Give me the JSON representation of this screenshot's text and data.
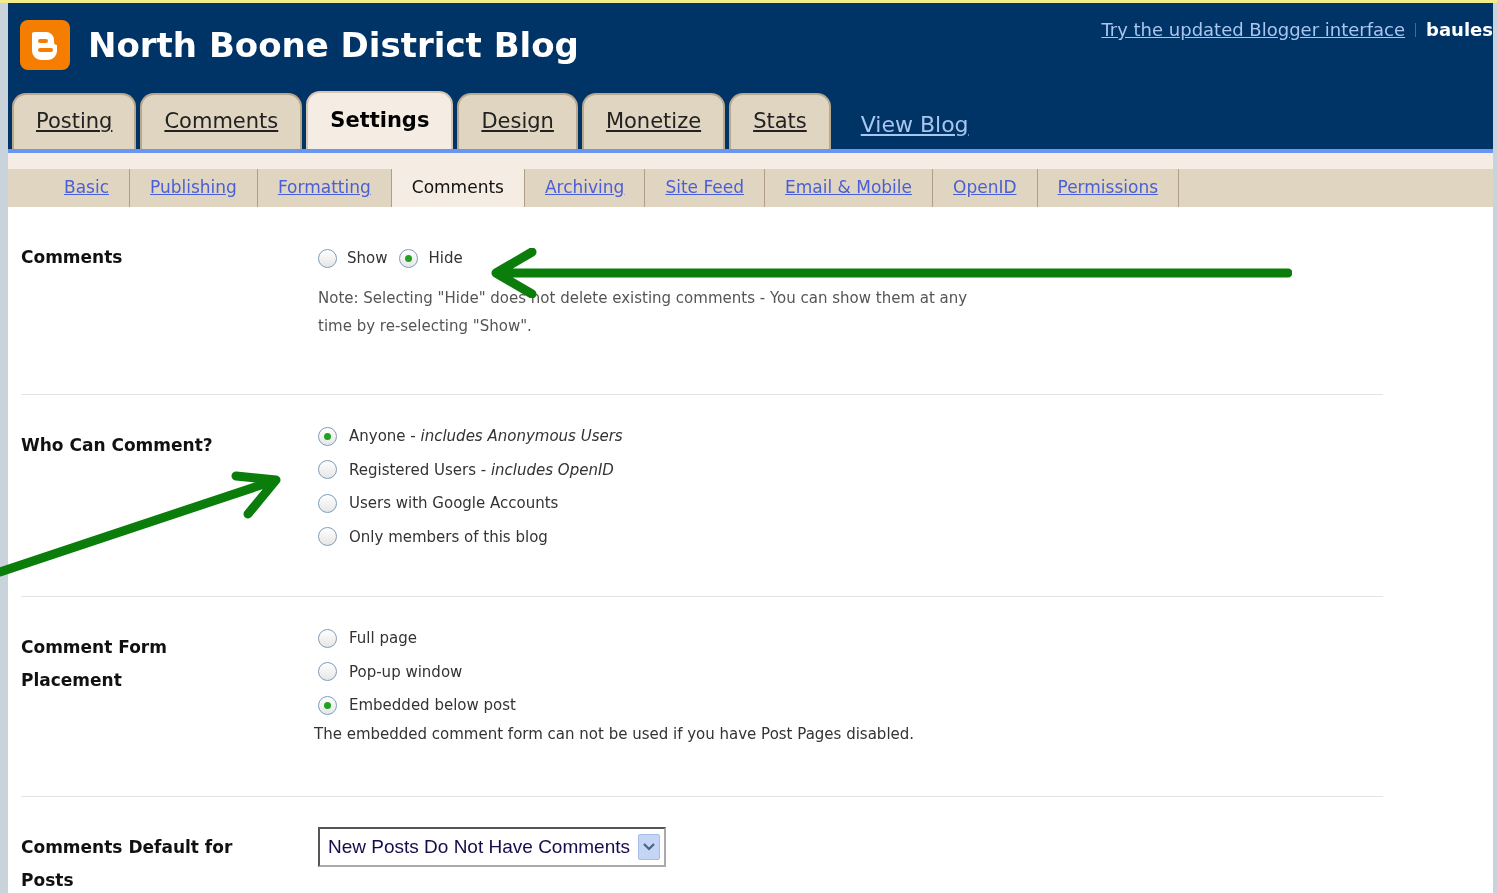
{
  "header": {
    "title": "North Boone District Blog",
    "try_link": "Try the updated Blogger interface",
    "user": "baules"
  },
  "main_tabs": [
    {
      "label": "Posting",
      "selected": false
    },
    {
      "label": "Comments",
      "selected": false
    },
    {
      "label": "Settings",
      "selected": true
    },
    {
      "label": "Design",
      "selected": false
    },
    {
      "label": "Monetize",
      "selected": false
    },
    {
      "label": "Stats",
      "selected": false
    }
  ],
  "view_blog": "View Blog",
  "sub_tabs": [
    {
      "label": "Basic",
      "selected": false
    },
    {
      "label": "Publishing",
      "selected": false
    },
    {
      "label": "Formatting",
      "selected": false
    },
    {
      "label": "Comments",
      "selected": true
    },
    {
      "label": "Archiving",
      "selected": false
    },
    {
      "label": "Site Feed",
      "selected": false
    },
    {
      "label": "Email & Mobile",
      "selected": false
    },
    {
      "label": "OpenID",
      "selected": false
    },
    {
      "label": "Permissions",
      "selected": false
    }
  ],
  "sections": [
    {
      "kind": "inline",
      "label": "Comments",
      "options": [
        {
          "label": "Show",
          "selected": false
        },
        {
          "label": "Hide",
          "selected": true
        }
      ],
      "note": "Note: Selecting \"Hide\" does not delete existing comments - You can show them at any time by re-selecting \"Show\"."
    },
    {
      "kind": "stacked",
      "label": "Who Can Comment?",
      "options": [
        {
          "label": "Anyone - *includes Anonymous Users*",
          "selected": true
        },
        {
          "label": "Registered Users - *includes OpenID*",
          "selected": false
        },
        {
          "label": "Users with Google Accounts",
          "selected": false
        },
        {
          "label": "Only members of this blog",
          "selected": false
        }
      ]
    },
    {
      "kind": "stacked",
      "label": "Comment Form Placement",
      "options": [
        {
          "label": "Full page",
          "selected": false
        },
        {
          "label": "Pop-up window",
          "selected": false
        },
        {
          "label": "Embedded below post",
          "selected": true
        }
      ],
      "note": "The embedded comment form can not be used if you have Post Pages disabled."
    },
    {
      "kind": "select",
      "label": "Comments Default for Posts",
      "value": "New Posts Do Not Have Comments"
    }
  ]
}
